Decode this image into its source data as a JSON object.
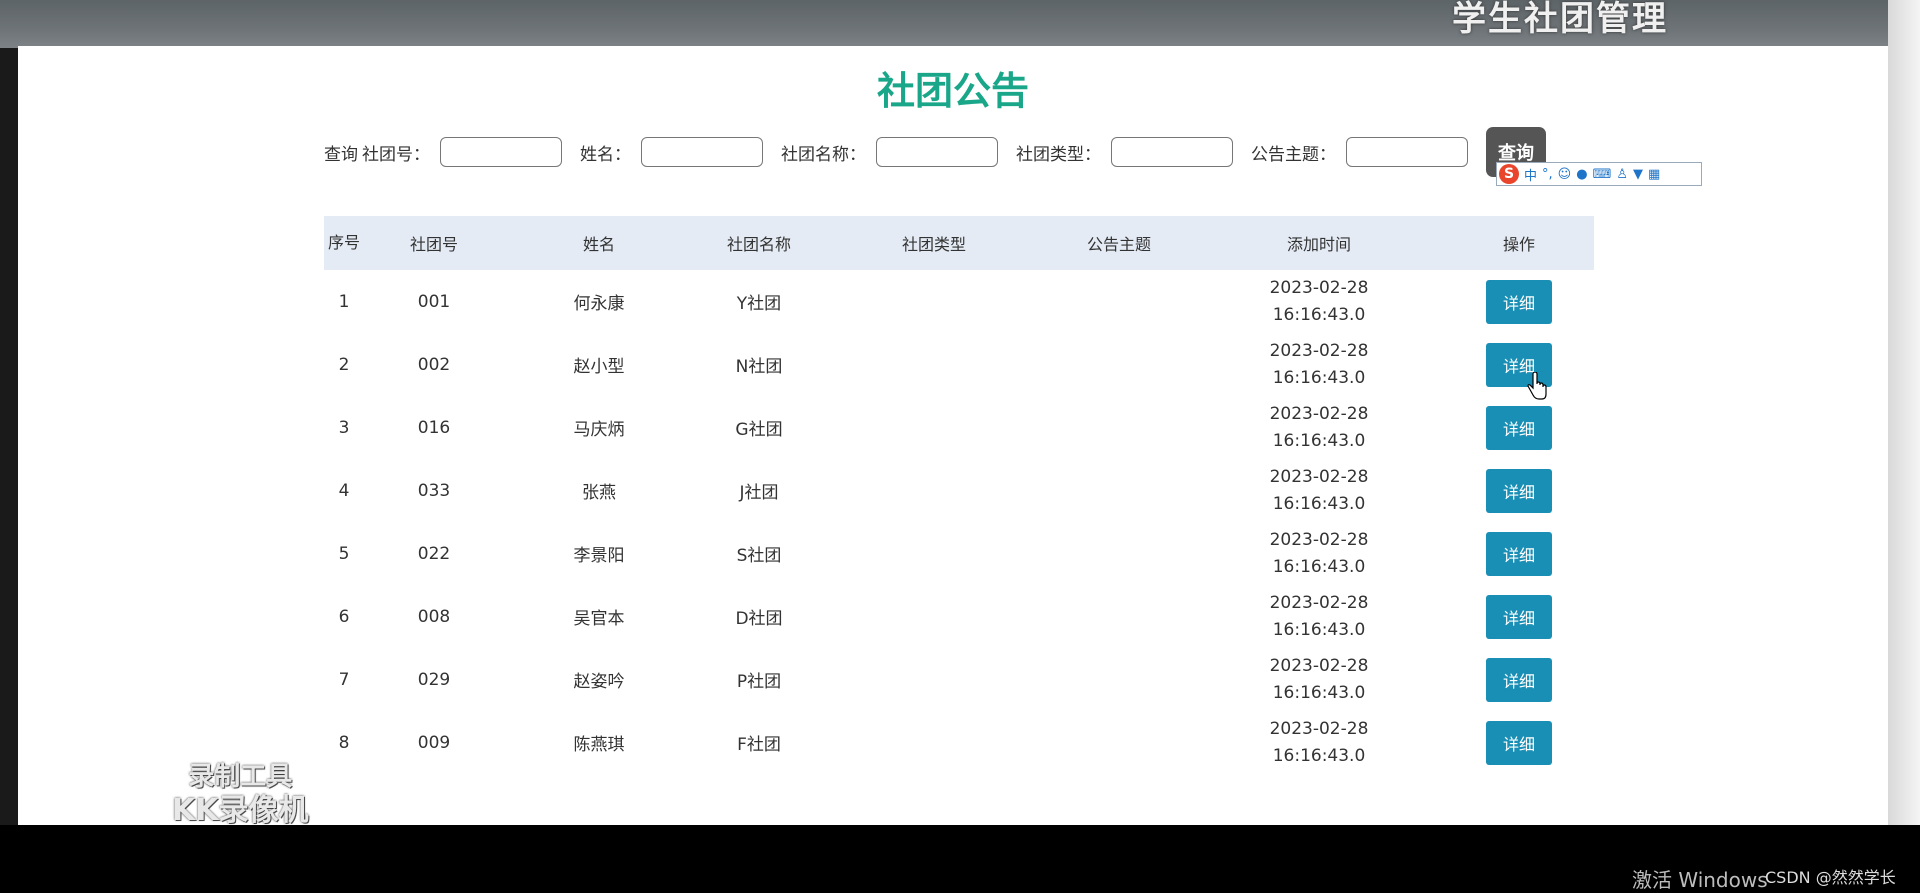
{
  "header": {
    "system_title": "学生社团管理"
  },
  "page": {
    "title": "社团公告"
  },
  "search": {
    "query_label": "查询",
    "fields": [
      {
        "label": "社团号：",
        "value": ""
      },
      {
        "label": "姓名：",
        "value": ""
      },
      {
        "label": "社团名称：",
        "value": ""
      },
      {
        "label": "社团类型：",
        "value": ""
      },
      {
        "label": "公告主题：",
        "value": ""
      }
    ],
    "button_label": "查询"
  },
  "ime_toolbar": {
    "logo": "S",
    "mode": "中"
  },
  "table": {
    "columns": [
      "序号",
      "社团号",
      "姓名",
      "社团名称",
      "社团类型",
      "公告主题",
      "添加时间",
      "操作"
    ],
    "rows": [
      {
        "index": "1",
        "club_no": "001",
        "name": "何永康",
        "club_name": "Y社团",
        "club_type": "",
        "notice_subject": "",
        "added_date": "2023-02-28",
        "added_time": "16:16:43.0",
        "action": "详细"
      },
      {
        "index": "2",
        "club_no": "002",
        "name": "赵小型",
        "club_name": "N社团",
        "club_type": "",
        "notice_subject": "",
        "added_date": "2023-02-28",
        "added_time": "16:16:43.0",
        "action": "详细"
      },
      {
        "index": "3",
        "club_no": "016",
        "name": "马庆炳",
        "club_name": "G社团",
        "club_type": "",
        "notice_subject": "",
        "added_date": "2023-02-28",
        "added_time": "16:16:43.0",
        "action": "详细"
      },
      {
        "index": "4",
        "club_no": "033",
        "name": "张燕",
        "club_name": "J社团",
        "club_type": "",
        "notice_subject": "",
        "added_date": "2023-02-28",
        "added_time": "16:16:43.0",
        "action": "详细"
      },
      {
        "index": "5",
        "club_no": "022",
        "name": "李景阳",
        "club_name": "S社团",
        "club_type": "",
        "notice_subject": "",
        "added_date": "2023-02-28",
        "added_time": "16:16:43.0",
        "action": "详细"
      },
      {
        "index": "6",
        "club_no": "008",
        "name": "吴官本",
        "club_name": "D社团",
        "club_type": "",
        "notice_subject": "",
        "added_date": "2023-02-28",
        "added_time": "16:16:43.0",
        "action": "详细"
      },
      {
        "index": "7",
        "club_no": "029",
        "name": "赵姿吟",
        "club_name": "P社团",
        "club_type": "",
        "notice_subject": "",
        "added_date": "2023-02-28",
        "added_time": "16:16:43.0",
        "action": "详细"
      },
      {
        "index": "8",
        "club_no": "009",
        "name": "陈燕琪",
        "club_name": "F社团",
        "club_type": "",
        "notice_subject": "",
        "added_date": "2023-02-28",
        "added_time": "16:16:43.0",
        "action": "详细"
      }
    ]
  },
  "overlay": {
    "watermark_line1": "录制工具",
    "watermark_line2": "KK录像机",
    "activate_text": "激活 Windows",
    "csdn_text": "CSDN @然然学长"
  }
}
